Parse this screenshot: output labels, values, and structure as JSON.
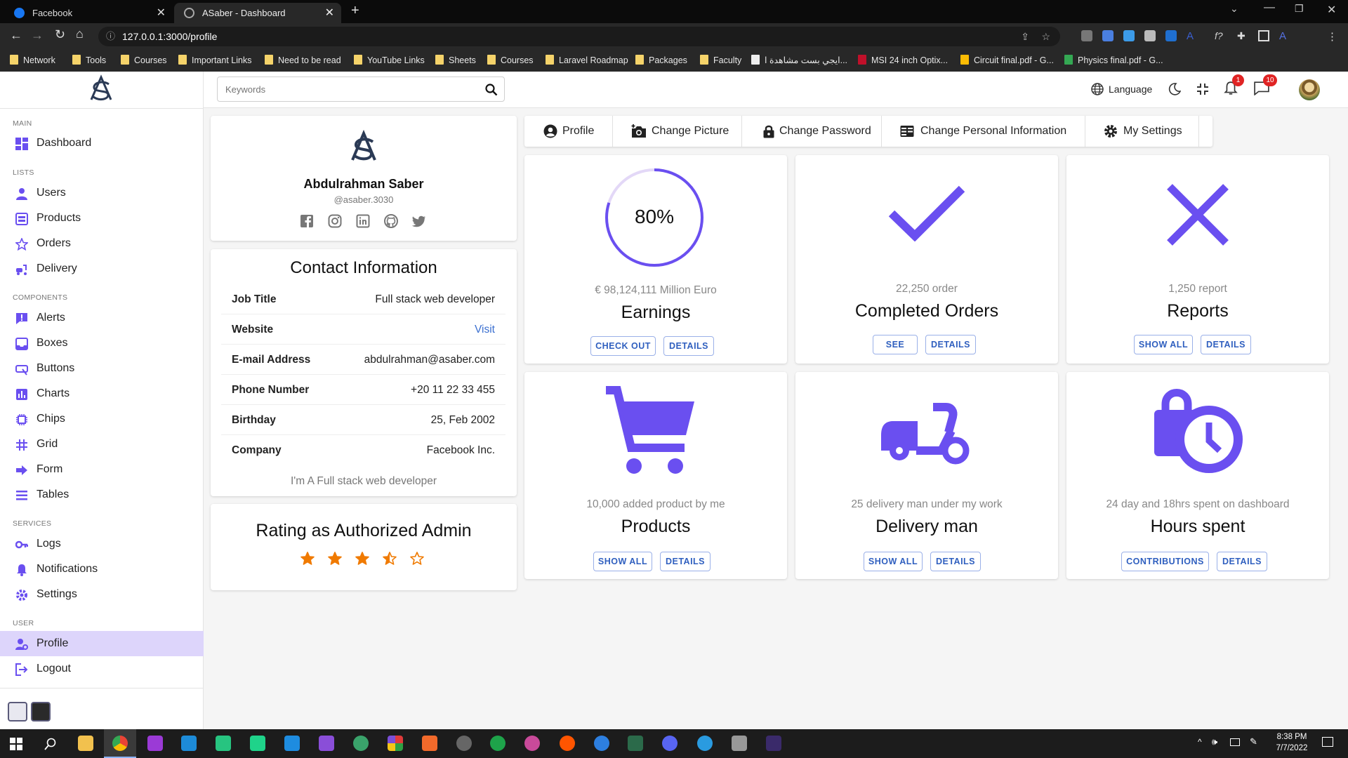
{
  "browser": {
    "tabs": [
      {
        "title": "Facebook",
        "active": false
      },
      {
        "title": "ASaber - Dashboard",
        "active": true
      }
    ],
    "url": "127.0.0.1:3000/profile",
    "bookmarks": [
      "Network",
      "Tools",
      "Courses",
      "Important Links",
      "Need to be read",
      "YouTube Links",
      "Sheets",
      "Courses",
      "Laravel Roadmap",
      "Packages",
      "Faculty",
      "ايجي بست مشاهدة ا...",
      "MSI 24 inch Optix...",
      "Circuit final.pdf - G...",
      "Physics final.pdf - G..."
    ]
  },
  "topbar": {
    "search_placeholder": "Keywords",
    "language": "Language",
    "notifications_count": "1",
    "messages_count": "10"
  },
  "sidebar": {
    "main": "MAIN",
    "lists": "LISTS",
    "components": "COMPONENTS",
    "services": "SERVICES",
    "user": "USER",
    "items": {
      "dashboard": "Dashboard",
      "users": "Users",
      "products": "Products",
      "orders": "Orders",
      "delivery": "Delivery",
      "alerts": "Alerts",
      "boxes": "Boxes",
      "buttons": "Buttons",
      "charts": "Charts",
      "chips": "Chips",
      "grid": "Grid",
      "form": "Form",
      "tables": "Tables",
      "logs": "Logs",
      "notifications": "Notifications",
      "settings": "Settings",
      "profile": "Profile",
      "logout": "Logout"
    }
  },
  "profile": {
    "name": "Abdulrahman Saber",
    "handle": "@asaber.3030",
    "socials": [
      "facebook-icon",
      "instagram-icon",
      "linkedin-icon",
      "github-icon",
      "twitter-icon"
    ]
  },
  "contact": {
    "title": "Contact Information",
    "rows": [
      {
        "key": "Job Title",
        "value": "Full stack web developer"
      },
      {
        "key": "Website",
        "value": "Visit"
      },
      {
        "key": "E-mail Address",
        "value": "abdulrahman@asaber.com"
      },
      {
        "key": "Phone Number",
        "value": "+20 11 22 33 455"
      },
      {
        "key": "Birthday",
        "value": "25, Feb 2002"
      },
      {
        "key": "Company",
        "value": "Facebook Inc."
      }
    ],
    "bio": "I'm A Full stack web developer"
  },
  "rating": {
    "title": "Rating as Authorized Admin",
    "value": 3.5,
    "max": 5
  },
  "tabs": {
    "profile": "Profile",
    "change_picture": "Change Picture",
    "change_password": "Change Password",
    "change_personal": "Change Personal Information",
    "settings": "My Settings"
  },
  "stats": {
    "earnings": {
      "percent_text": "80%",
      "percent": 80,
      "sub": "€ 98,124,111 Million Euro",
      "title": "Earnings",
      "btn1": "CHECK OUT",
      "btn2": "DETAILS"
    },
    "orders": {
      "sub": "22,250 order",
      "title": "Completed Orders",
      "btn1": "SEE",
      "btn2": "DETAILS"
    },
    "reports": {
      "sub": "1,250 report",
      "title": "Reports",
      "btn1": "SHOW ALL",
      "btn2": "DETAILS"
    },
    "products": {
      "sub": "10,000 added product by me",
      "title": "Products",
      "btn1": "SHOW ALL",
      "btn2": "DETAILS"
    },
    "delivery": {
      "sub": "25 delivery man under my work",
      "title": "Delivery man",
      "btn1": "SHOW ALL",
      "btn2": "DETAILS"
    },
    "hours": {
      "sub": "24 day and 18hrs spent on dashboard",
      "title": "Hours spent",
      "btn1": "CONTRIBUTIONS",
      "btn2": "DETAILS"
    }
  },
  "taskbar": {
    "time": "8:38 PM",
    "date": "7/7/2022"
  },
  "colors": {
    "accent": "#6a4ff0",
    "active_bg": "#ddd5fb",
    "star": "#f07a00",
    "link": "#2f5fbf"
  }
}
